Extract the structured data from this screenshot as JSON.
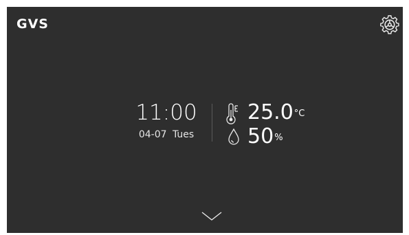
{
  "header": {
    "logo_text": "GVS",
    "settings_icon": "gear-icon"
  },
  "clock": {
    "time": "11:00",
    "date": "04-07 Tues"
  },
  "climate": {
    "temperature_value": "25.0",
    "temperature_unit": "°C",
    "humidity_value": "50",
    "humidity_unit": "%",
    "temperature_icon": "thermometer-icon",
    "humidity_icon": "droplet-icon"
  },
  "footer": {
    "expand_icon": "chevron-down-icon"
  },
  "colors": {
    "background": "#2e2e2e",
    "text": "#ffffff",
    "divider": "#5a5a5a"
  }
}
